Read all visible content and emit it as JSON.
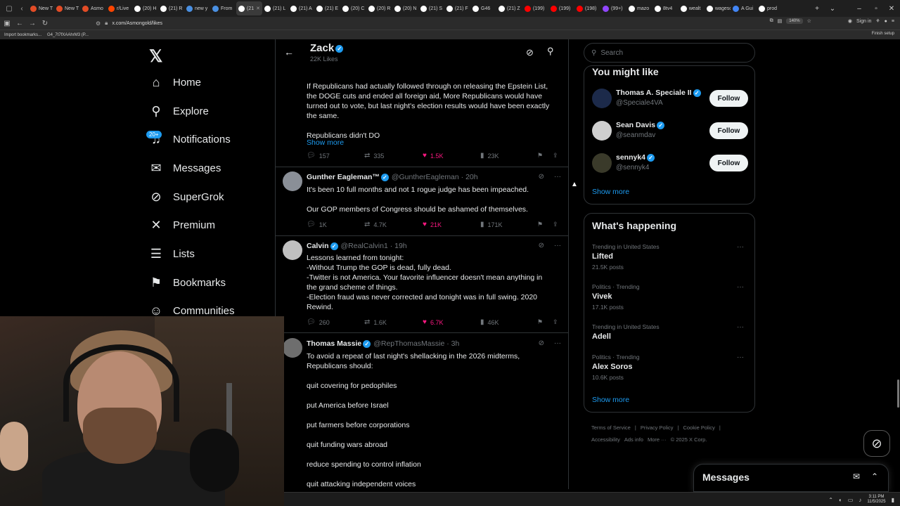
{
  "browser": {
    "tabs": [
      {
        "label": "New T",
        "color": "#e34c26"
      },
      {
        "label": "New T",
        "color": "#e34c26"
      },
      {
        "label": "Asmo",
        "color": "#e34c26"
      },
      {
        "label": "r/Live",
        "color": "#ff4500"
      },
      {
        "label": "(20) H",
        "color": "#ffffff"
      },
      {
        "label": "(21) R",
        "color": "#ffffff"
      },
      {
        "label": "new y",
        "color": "#4a90e2"
      },
      {
        "label": "From",
        "color": "#4a90e2"
      },
      {
        "label": "(21",
        "color": "#ffffff",
        "active": true
      },
      {
        "label": "(21) L",
        "color": "#ffffff"
      },
      {
        "label": "(21) A",
        "color": "#ffffff"
      },
      {
        "label": "(21) E",
        "color": "#ffffff"
      },
      {
        "label": "(20) C",
        "color": "#ffffff"
      },
      {
        "label": "(20) R",
        "color": "#ffffff"
      },
      {
        "label": "(20) N",
        "color": "#ffffff"
      },
      {
        "label": "(21) S",
        "color": "#ffffff"
      },
      {
        "label": "(21) F",
        "color": "#ffffff"
      },
      {
        "label": "G46",
        "color": "#ffffff"
      },
      {
        "label": "(21) Z",
        "color": "#ffffff"
      },
      {
        "label": "(199)",
        "color": "#ff0000"
      },
      {
        "label": "(199)",
        "color": "#ff0000"
      },
      {
        "label": "(198)",
        "color": "#ff0000"
      },
      {
        "label": "(99+)",
        "color": "#9146ff"
      },
      {
        "label": "mazo",
        "color": "#ffffff"
      },
      {
        "label": "8tv4",
        "color": "#ffffff"
      },
      {
        "label": "wealt",
        "color": "#ffffff"
      },
      {
        "label": "wagescor",
        "color": "#ffffff"
      },
      {
        "label": "A Gui",
        "color": "#4285f4"
      },
      {
        "label": "prod",
        "color": "#ffffff"
      }
    ],
    "url": "x.com/Asmongold/likes",
    "zoom": "140%",
    "sign_in": "Sign in",
    "bookmarks": [
      "Import bookmarks...",
      "G4_7t7fXAAhrM3 (P..."
    ],
    "finish_setup": "Finish setup"
  },
  "nav": {
    "items": [
      {
        "label": "Home",
        "icon": "home-icon",
        "glyph": "⌂"
      },
      {
        "label": "Explore",
        "icon": "search-icon",
        "glyph": "⚲"
      },
      {
        "label": "Notifications",
        "icon": "bell-icon",
        "glyph": "♫"
      },
      {
        "label": "Messages",
        "icon": "envelope-icon",
        "glyph": "✉"
      },
      {
        "label": "SuperGrok",
        "icon": "grok-icon",
        "glyph": "⊘"
      },
      {
        "label": "Premium",
        "icon": "x-logo-icon",
        "glyph": "✕"
      },
      {
        "label": "Lists",
        "icon": "list-icon",
        "glyph": "☰"
      },
      {
        "label": "Bookmarks",
        "icon": "bookmark-icon",
        "glyph": "⚑"
      },
      {
        "label": "Communities",
        "icon": "people-icon",
        "glyph": "☺"
      }
    ],
    "notif_badge": "20+"
  },
  "profile_header": {
    "title": "Zack",
    "subtitle": "22K Likes"
  },
  "tweets": [
    {
      "name": "",
      "handle": "",
      "time": "",
      "lines": [
        "If Republicans had actually followed through on releasing the Epstein List,",
        "the DOGE cuts and ended all foreign aid, More Republicans would have",
        "turned out to vote, but last night's election results would have been exactly",
        "the same.",
        "",
        "Republicans didn't DO"
      ],
      "show_more": "Show more",
      "replies": "157",
      "reposts": "335",
      "likes": "1.5K",
      "views": "23K"
    },
    {
      "name": "Gunther Eagleman™",
      "handle": "@GuntherEagleman · 20h",
      "lines": [
        "It's been 10 full months and not 1 rogue judge has been impeached.",
        "",
        "Our GOP members of Congress should be ashamed of themselves."
      ],
      "replies": "1K",
      "reposts": "4.7K",
      "likes": "21K",
      "views": "171K"
    },
    {
      "name": "Calvin",
      "handle": "@RealCalvin1 · 19h",
      "lines": [
        "Lessons learned from tonight:",
        "-Without Trump the GOP is dead, fully dead.",
        "-Twitter is not America. Your favorite influencer doesn't mean anything in",
        "the grand scheme of things.",
        "-Election fraud was never corrected and tonight was in full swing. 2020",
        "Rewind."
      ],
      "replies": "260",
      "reposts": "1.6K",
      "likes": "6.7K",
      "views": "46K"
    },
    {
      "name": "Thomas Massie",
      "handle": "@RepThomasMassie · 3h",
      "lines": [
        "To avoid a repeat of last night's shellacking in the 2026 midterms,",
        "Republicans should:",
        "",
        "quit covering for pedophiles",
        "",
        "put America before Israel",
        "",
        "put farmers before corporations",
        "",
        "quit funding wars abroad",
        "",
        "reduce spending to control inflation",
        "",
        "quit attacking independent voices"
      ]
    }
  ],
  "right": {
    "search_placeholder": "Search",
    "wtf_title": "You might like",
    "who_to_follow": [
      {
        "name": "Thomas A. Speciale II",
        "handle": "@Speciale4VA",
        "button": "Follow"
      },
      {
        "name": "Sean Davis",
        "handle": "@seanmdav",
        "button": "Follow"
      },
      {
        "name": "sennyk4",
        "handle": "@sennyk4",
        "button": "Follow"
      }
    ],
    "wtf_show_more": "Show more",
    "happening_title": "What's happening",
    "trends": [
      {
        "context": "Trending in United States",
        "title": "Lifted",
        "posts": "21.5K posts"
      },
      {
        "context": "Politics · Trending",
        "title": "Vivek",
        "posts": "17.1K posts"
      },
      {
        "context": "Trending in United States",
        "title": "Adell",
        "posts": ""
      },
      {
        "context": "Politics · Trending",
        "title": "Alex Soros",
        "posts": "10.6K posts"
      }
    ],
    "trends_show_more": "Show more",
    "footer_row1": [
      "Terms of Service",
      "|",
      "Privacy Policy",
      "|",
      "Cookie Policy",
      "|"
    ],
    "footer_row2": [
      "Accessibility",
      "Ads info",
      "More ···",
      "© 2025 X Corp."
    ]
  },
  "messages_dock": {
    "title": "Messages"
  },
  "taskbar": {
    "time": "3:11 PM",
    "date": "11/5/2025"
  },
  "colors": {
    "accent": "#1d9bf0",
    "like": "#f91880",
    "text": "#e7e9ea",
    "muted": "#71767b",
    "border": "#2f3336"
  }
}
